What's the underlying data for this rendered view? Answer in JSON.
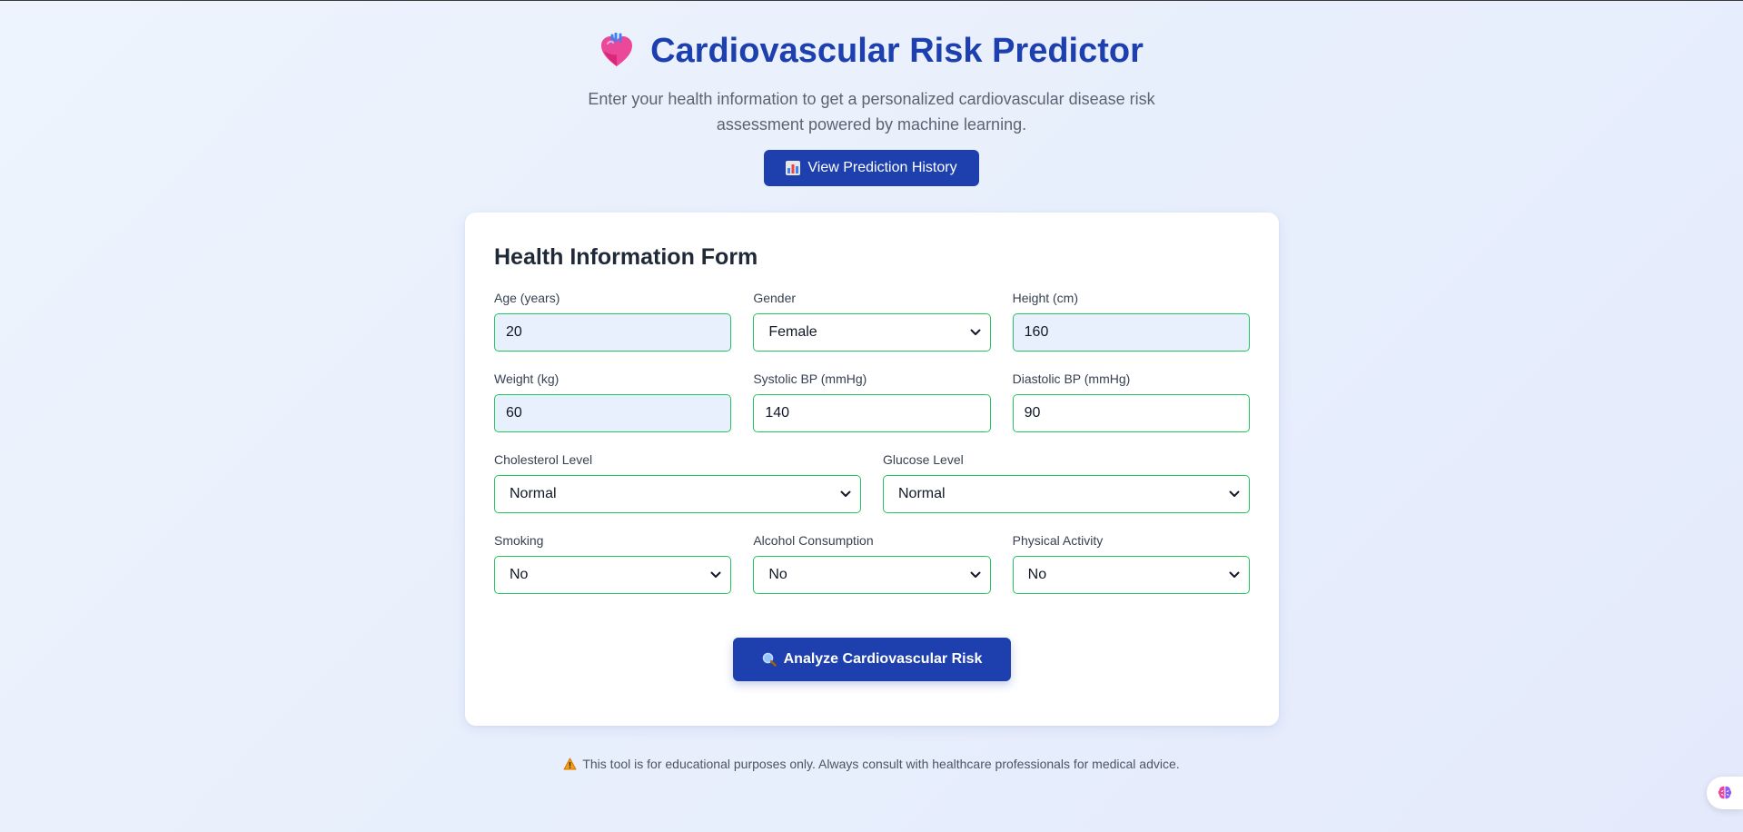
{
  "header": {
    "title": "Cardiovascular Risk Predictor",
    "title_icon": "heart-icon",
    "subtitle": "Enter your health information to get a personalized cardiovascular disease risk assessment powered by machine learning.",
    "history_button": {
      "icon": "bar-chart-icon",
      "label": "View Prediction History"
    }
  },
  "form": {
    "title": "Health Information Form",
    "fields": {
      "age": {
        "label": "Age (years)",
        "value": "20"
      },
      "gender": {
        "label": "Gender",
        "value": "Female"
      },
      "height": {
        "label": "Height (cm)",
        "value": "160"
      },
      "weight": {
        "label": "Weight (kg)",
        "value": "60"
      },
      "systolic": {
        "label": "Systolic BP (mmHg)",
        "value": "140"
      },
      "diastolic": {
        "label": "Diastolic BP (mmHg)",
        "value": "90"
      },
      "cholesterol": {
        "label": "Cholesterol Level",
        "value": "Normal"
      },
      "glucose": {
        "label": "Glucose Level",
        "value": "Normal"
      },
      "smoking": {
        "label": "Smoking",
        "value": "No"
      },
      "alcohol": {
        "label": "Alcohol Consumption",
        "value": "No"
      },
      "activity": {
        "label": "Physical Activity",
        "value": "No"
      }
    },
    "submit": {
      "icon": "magnifier-icon",
      "label": "Analyze Cardiovascular Risk"
    }
  },
  "footer": {
    "icon": "warning-icon",
    "disclaimer": "This tool is for educational purposes only. Always consult with healthcare professionals for medical advice."
  },
  "colors": {
    "primary": "#1e40af",
    "field_border": "#22c55e",
    "autofill_bg": "#e8f0fe",
    "page_bg": "#eef4fd"
  }
}
